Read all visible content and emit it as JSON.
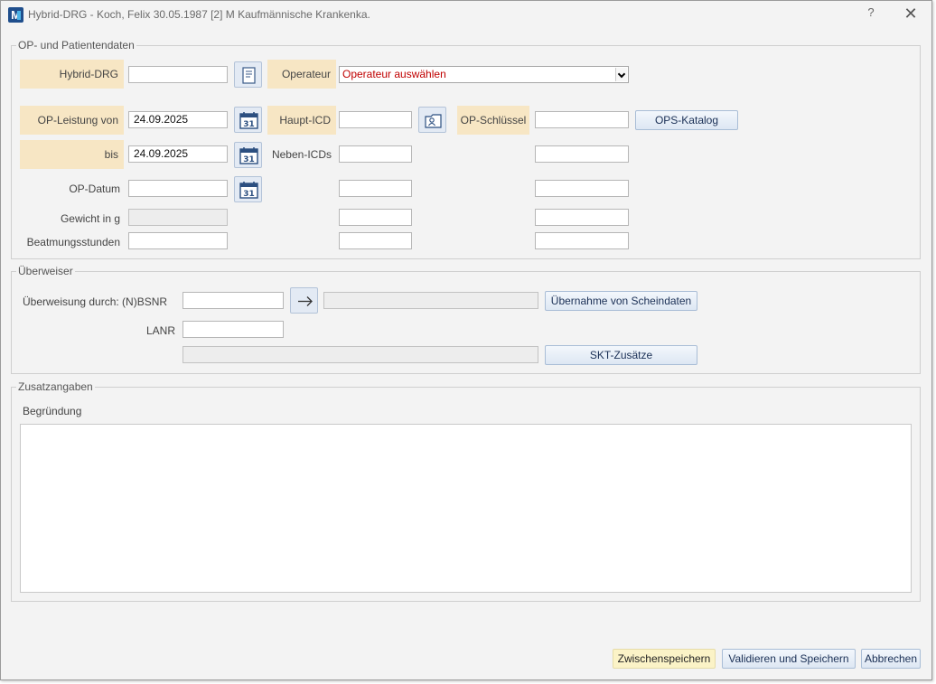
{
  "window": {
    "title": "Hybrid-DRG - Koch, Felix 30.05.1987 [2] M Kaufmännische Krankenka.",
    "help": "?",
    "close": "✕"
  },
  "op_section": {
    "legend": "OP- und Patientendaten",
    "hybrid_drg_label": "Hybrid-DRG",
    "hybrid_drg_value": "",
    "operateur_label": "Operateur",
    "operateur_value": "Operateur auswählen",
    "op_leistung_von_label": "OP-Leistung von",
    "op_leistung_von_value": "24.09.2025",
    "bis_label": "bis",
    "bis_value": "24.09.2025",
    "op_datum_label": "OP-Datum",
    "op_datum_value": "",
    "gewicht_label": "Gewicht in g",
    "gewicht_value": "",
    "beatmung_label": "Beatmungsstunden",
    "beatmung_value": "",
    "haupt_icd_label": "Haupt-ICD",
    "neben_icds_label": "Neben-ICDs",
    "op_schluessel_label": "OP-Schlüssel",
    "ops_katalog_button": "OPS-Katalog",
    "calendar_day": "31"
  },
  "ueberweiser": {
    "legend": "Überweiser",
    "bsnr_label": "Überweisung durch: (N)BSNR",
    "lanr_label": "LANR",
    "uebernahme_button": "Übernahme von Scheindaten",
    "skt_button": "SKT-Zusätze"
  },
  "zusatz": {
    "legend": "Zusatzangaben",
    "begruendung_label": "Begründung"
  },
  "footer": {
    "zwischenspeichern": "Zwischenspeichern",
    "validieren": "Validieren und Speichern",
    "abbrechen": "Abbrechen"
  },
  "colors": {
    "highlight": "#f7e6c4",
    "operateur_text": "#c00000",
    "button_blue": "#dde7f3",
    "button_yellow": "#fbf3c7"
  }
}
